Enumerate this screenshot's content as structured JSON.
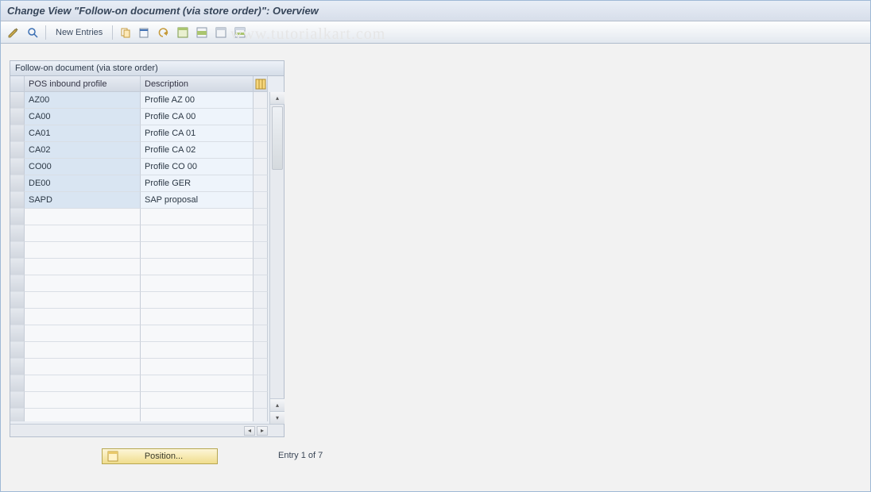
{
  "title": "Change View \"Follow-on document (via store order)\": Overview",
  "toolbar": {
    "new_entries": "New Entries"
  },
  "watermark": "www.tutorialkart.com",
  "panel": {
    "title": "Follow-on document (via store order)",
    "columns": {
      "profile": "POS inbound profile",
      "description": "Description"
    },
    "rows": [
      {
        "profile": "AZ00",
        "description": "Profile AZ 00"
      },
      {
        "profile": "CA00",
        "description": "Profile CA 00"
      },
      {
        "profile": "CA01",
        "description": "Profile CA 01"
      },
      {
        "profile": "CA02",
        "description": "Profile CA 02"
      },
      {
        "profile": "CO00",
        "description": "Profile CO 00"
      },
      {
        "profile": "DE00",
        "description": "Profile GER"
      },
      {
        "profile": "SAPD",
        "description": "SAP proposal"
      }
    ]
  },
  "position_button": "Position...",
  "entry_status": "Entry 1 of 7"
}
